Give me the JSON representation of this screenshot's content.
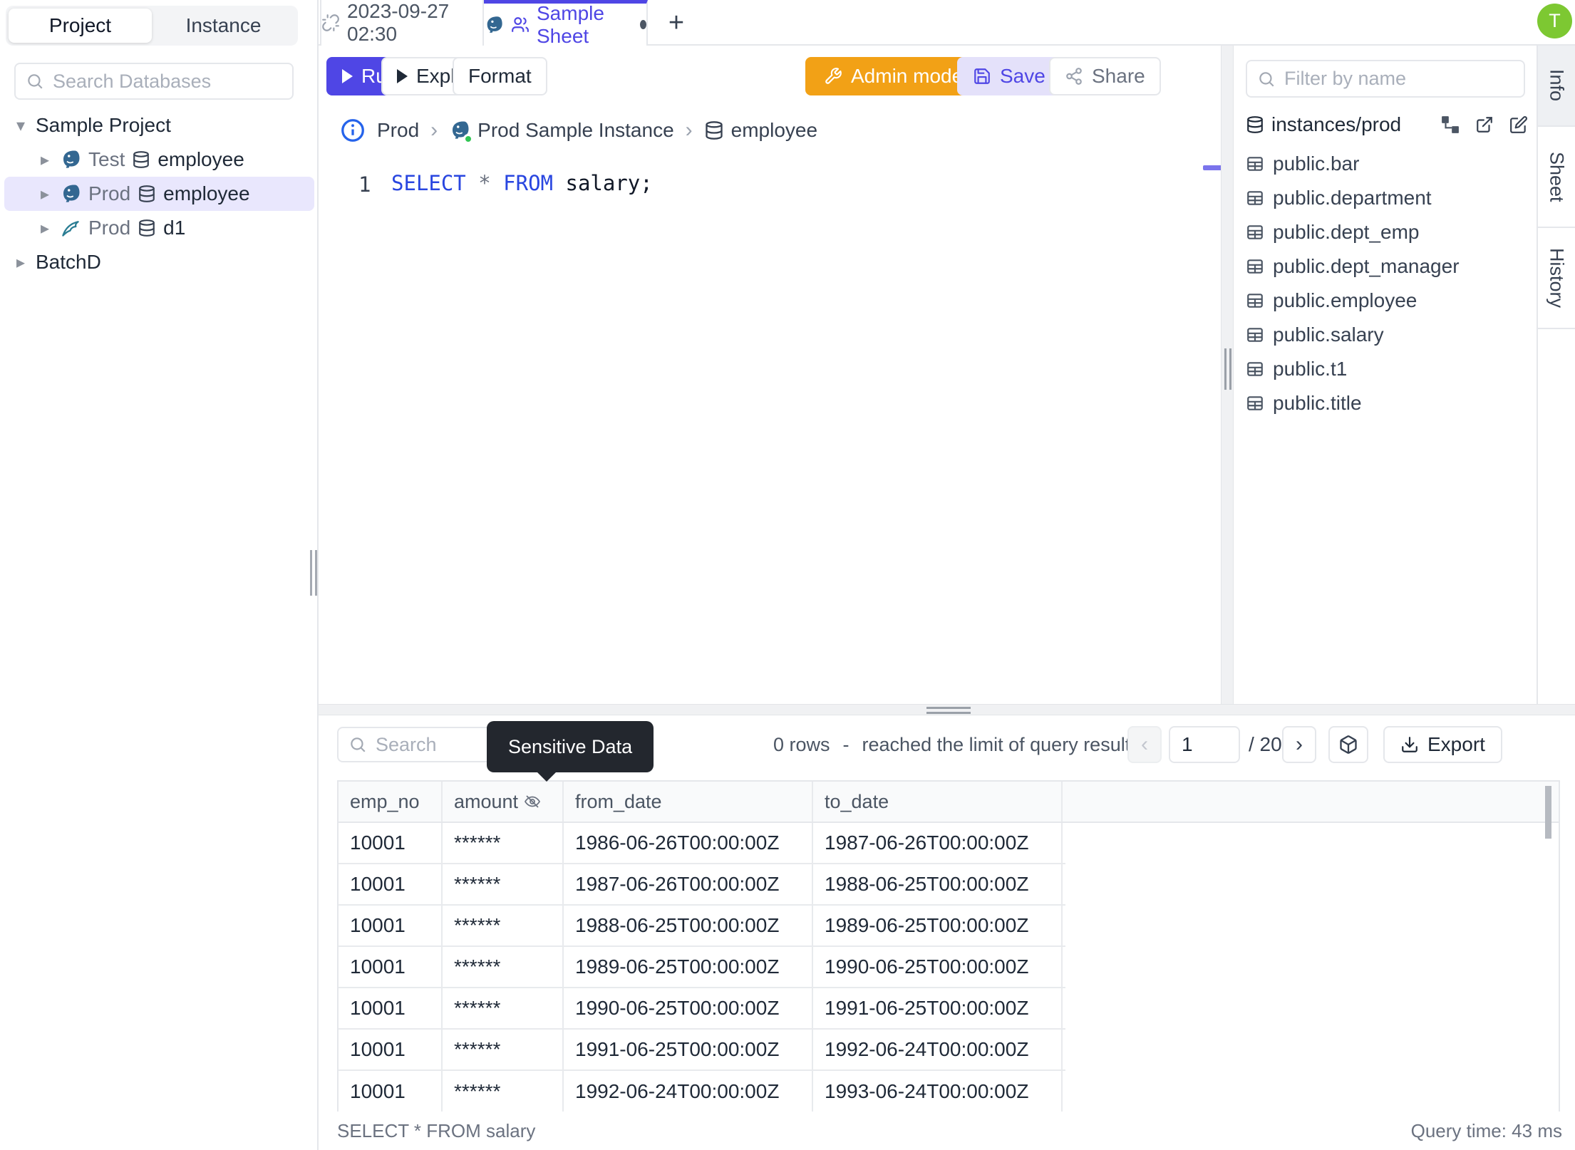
{
  "colors": {
    "accent": "#4f46e5",
    "accent-soft": "#e4e1fa",
    "admin": "#f2a116",
    "avatar": "#7dc832",
    "keyword": "#2946e0",
    "border": "#e5e7eb"
  },
  "glyphs": {
    "caret_down": "▾",
    "caret_right": "▸",
    "chevron_right": "›",
    "plus": "+",
    "prev": "‹",
    "next": "›"
  },
  "sidebar": {
    "tab_project": "Project",
    "tab_instance": "Instance",
    "search_placeholder": "Search Databases",
    "project1": "Sample Project",
    "nodes": [
      {
        "env": "Test",
        "db": "employee"
      },
      {
        "env": "Prod",
        "db": "employee"
      },
      {
        "env": "Prod",
        "db": "d1"
      }
    ],
    "project2": "BatchD"
  },
  "header": {
    "tab1": "2023-09-27 02:30",
    "tab2": "Sample Sheet",
    "avatar": "T"
  },
  "toolbar": {
    "run": "Run",
    "explain": "Explain",
    "format": "Format",
    "admin": "Admin mode",
    "save": "Save",
    "share": "Share"
  },
  "breadcrumb": {
    "env": "Prod",
    "instance": "Prod Sample Instance",
    "db": "employee"
  },
  "editor": {
    "line_no": "1",
    "kw_select": "SELECT",
    "op_star": "*",
    "kw_from": "FROM",
    "rest": "salary;"
  },
  "right_panel": {
    "filter_placeholder": "Filter by name",
    "path": "instances/prod",
    "tables": [
      "public.bar",
      "public.department",
      "public.dept_emp",
      "public.dept_manager",
      "public.employee",
      "public.salary",
      "public.t1",
      "public.title"
    ]
  },
  "side_tabs": {
    "info": "Info",
    "sheet": "Sheet",
    "history": "History"
  },
  "results": {
    "search_placeholder": "Search",
    "tooltip": "Sensitive Data",
    "row_count": "0 rows",
    "dash": "-",
    "limit_msg": "reached the limit of query results",
    "page": "1",
    "page_total": "/ 20",
    "export": "Export",
    "columns": [
      "emp_no",
      "amount",
      "from_date",
      "to_date"
    ],
    "rows": [
      [
        "10001",
        "******",
        "1986-06-26T00:00:00Z",
        "1987-06-26T00:00:00Z"
      ],
      [
        "10001",
        "******",
        "1987-06-26T00:00:00Z",
        "1988-06-25T00:00:00Z"
      ],
      [
        "10001",
        "******",
        "1988-06-25T00:00:00Z",
        "1989-06-25T00:00:00Z"
      ],
      [
        "10001",
        "******",
        "1989-06-25T00:00:00Z",
        "1990-06-25T00:00:00Z"
      ],
      [
        "10001",
        "******",
        "1990-06-25T00:00:00Z",
        "1991-06-25T00:00:00Z"
      ],
      [
        "10001",
        "******",
        "1991-06-25T00:00:00Z",
        "1992-06-24T00:00:00Z"
      ],
      [
        "10001",
        "******",
        "1992-06-24T00:00:00Z",
        "1993-06-24T00:00:00Z"
      ]
    ],
    "statement": "SELECT * FROM salary",
    "query_time": "Query time: 43 ms"
  }
}
